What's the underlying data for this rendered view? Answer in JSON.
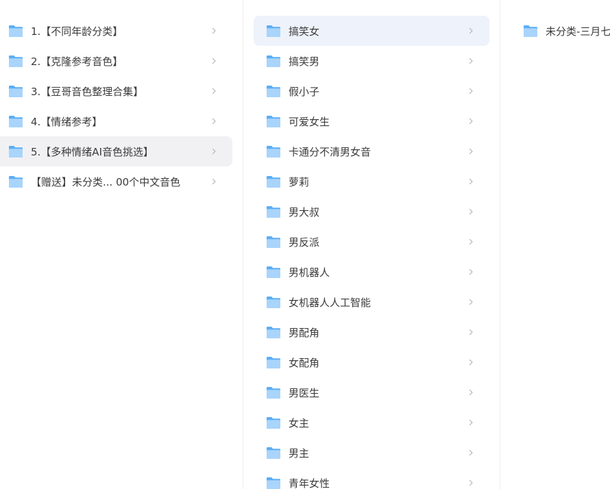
{
  "columns": [
    {
      "items": [
        {
          "label": "1.【不同年龄分类】",
          "selected": false
        },
        {
          "label": "2.【克隆参考音色】",
          "selected": false
        },
        {
          "label": "3.【豆哥音色整理合集】",
          "selected": false
        },
        {
          "label": "4.【情绪参考】",
          "selected": false
        },
        {
          "label": "5.【多种情绪AI音色挑选】",
          "selected": true
        },
        {
          "label": "【赠送】未分类... 00个中文音色",
          "selected": false
        }
      ]
    },
    {
      "items": [
        {
          "label": "搞笑女",
          "selected": true
        },
        {
          "label": "搞笑男",
          "selected": false
        },
        {
          "label": "假小子",
          "selected": false
        },
        {
          "label": "可爱女生",
          "selected": false
        },
        {
          "label": "卡通分不清男女音",
          "selected": false
        },
        {
          "label": "萝莉",
          "selected": false
        },
        {
          "label": "男大叔",
          "selected": false
        },
        {
          "label": "男反派",
          "selected": false
        },
        {
          "label": "男机器人",
          "selected": false
        },
        {
          "label": "女机器人人工智能",
          "selected": false
        },
        {
          "label": "男配角",
          "selected": false
        },
        {
          "label": "女配角",
          "selected": false
        },
        {
          "label": "男医生",
          "selected": false
        },
        {
          "label": "女主",
          "selected": false
        },
        {
          "label": "男主",
          "selected": false
        },
        {
          "label": "青年女性",
          "selected": false
        }
      ]
    },
    {
      "items": [
        {
          "label": "未分类-三月七",
          "selected": false
        }
      ]
    }
  ],
  "icons": {
    "folder": "folder-icon",
    "chevron": "chevron-right-icon"
  },
  "colors": {
    "folder_light": "#a9d4fb",
    "folder_dark": "#5aaef6",
    "selected_col1": "#f1f1f4",
    "selected_col2": "#eef2fb",
    "chevron": "#b3b3b8"
  }
}
